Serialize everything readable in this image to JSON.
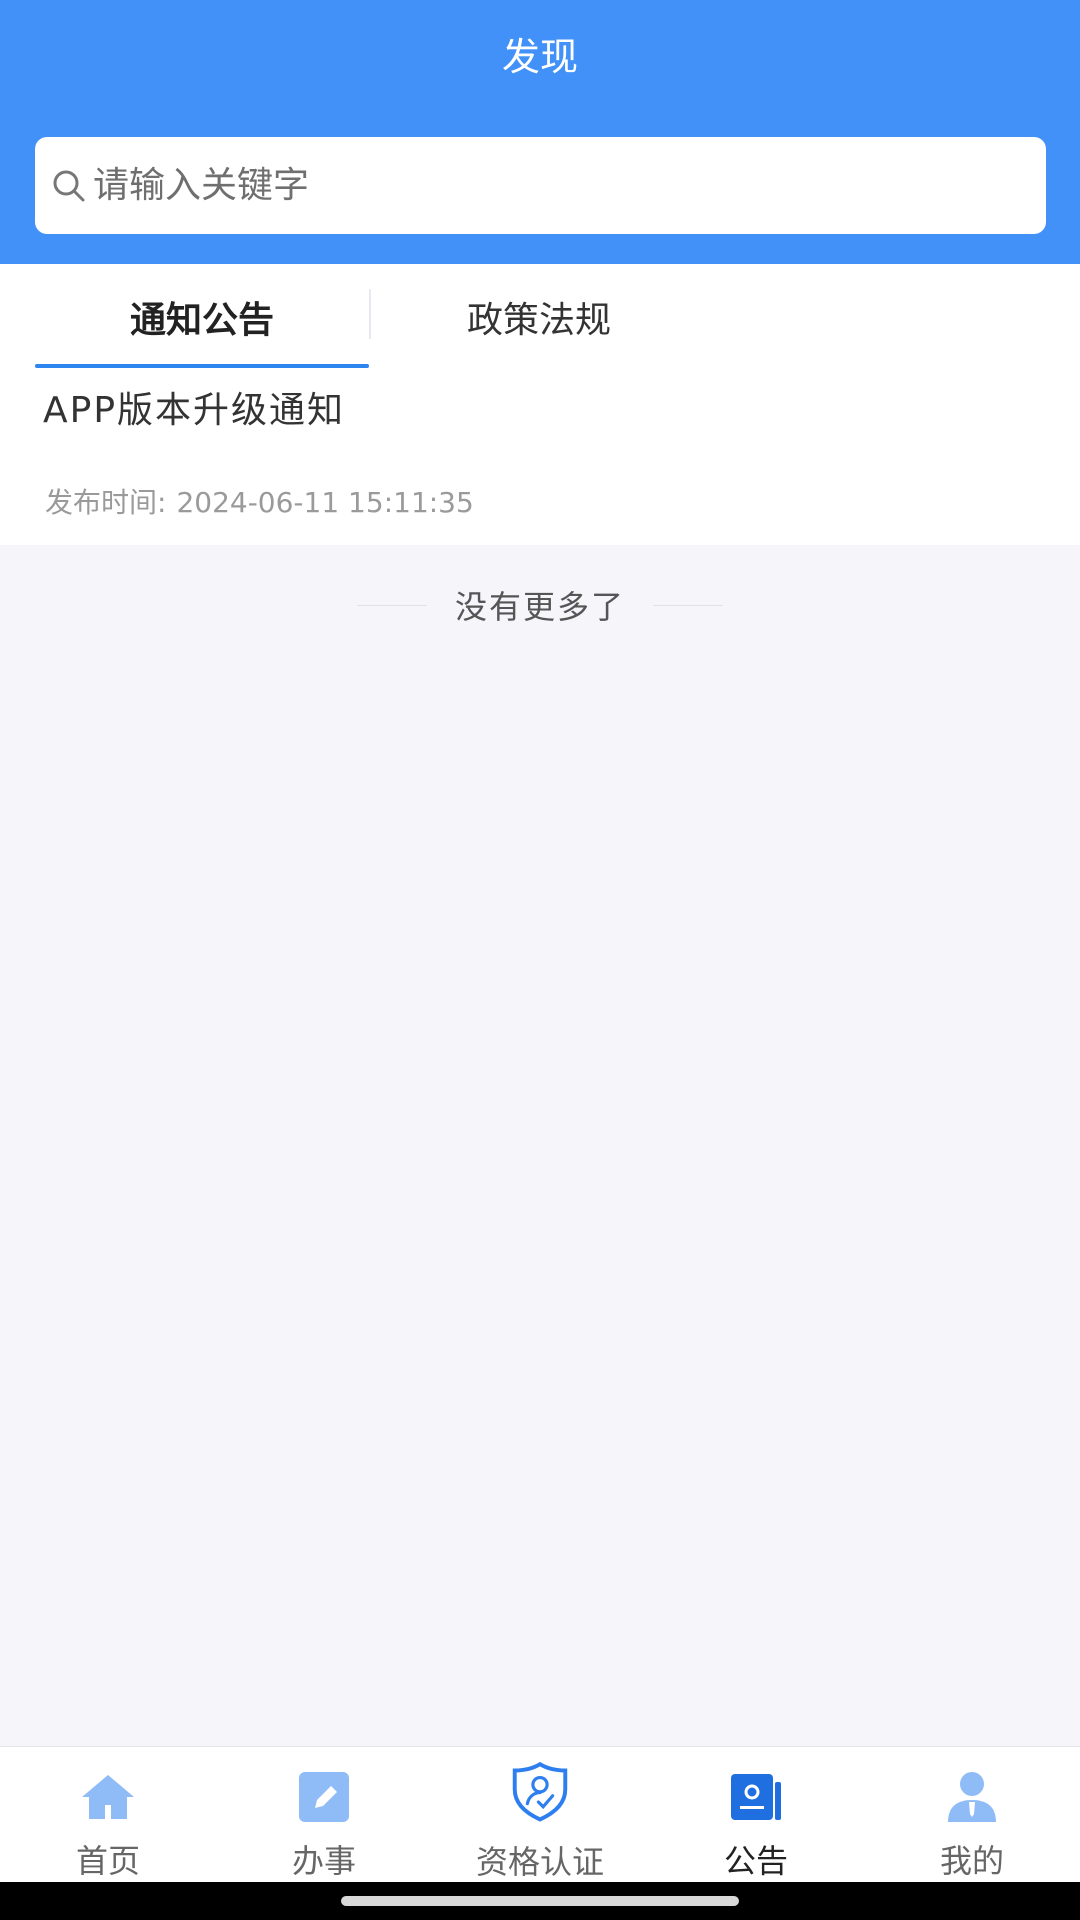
{
  "header": {
    "title": "发现",
    "search_placeholder": "请输入关键字"
  },
  "tabs": [
    {
      "label": "通知公告",
      "active": true
    },
    {
      "label": "政策法规",
      "active": false
    }
  ],
  "notices": [
    {
      "title": "APP版本升级通知",
      "time_label": "发布时间:",
      "time_value": "2024-06-11 15:11:35"
    }
  ],
  "list_end_text": "没有更多了",
  "bottom_nav": [
    {
      "label": "首页",
      "icon": "home-icon",
      "active": false
    },
    {
      "label": "办事",
      "icon": "edit-icon",
      "active": false
    },
    {
      "label": "资格认证",
      "icon": "shield-person-icon",
      "active": false
    },
    {
      "label": "公告",
      "icon": "notice-icon",
      "active": true
    },
    {
      "label": "我的",
      "icon": "person-icon",
      "active": false
    }
  ],
  "colors": {
    "header_bg": "#4191f9",
    "tab_underline": "#2d86f0",
    "page_bg": "#f5f5fa",
    "nav_icon_light": "#8fbbf7",
    "nav_icon_active": "#1f6fe0"
  }
}
